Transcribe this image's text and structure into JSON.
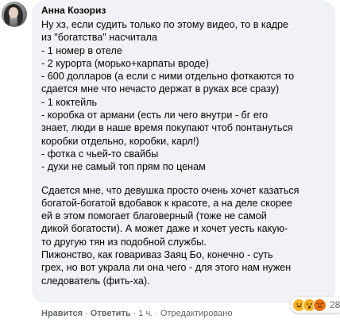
{
  "comment": {
    "author": "Анна Козориз",
    "lines": [
      "Ну хз, если судить только по этому видео, то в кадре",
      "из \"богатства\" насчитала",
      "- 1 номер в отеле",
      "- 2 курорта (морько+карпаты вроде)",
      "- 600 долларов (а если с ними отдельно фоткаются то",
      "сдается мне что нечасто держат в руках все сразу)",
      "- 1 коктейль",
      "- коробка от армани (есть ли чего внутри - бг его",
      "знает, люди в наше время покупают чтоб понтануться",
      "коробки отдельно, коробки, карл!)",
      "- фотка с чьей-то свайбы",
      "- духи не самый топ прям по ценам",
      "",
      "Сдается мне, что девушка просто очень хочет казаться",
      "богатой-богатой вдобавок к красоте, а на деле скорее",
      "ей в этом помогает благоверный (тоже не самой",
      "дикой богатости). А может даже и хочет уесть какую-",
      "то другую тян из подобной службы.",
      "Пижонство, как говариваз Заяц Бо, конечно - суть",
      "грех, но вот украла ли она чего - для этого нам нужен",
      "следователь (фить-ха)."
    ],
    "reactions": {
      "types": [
        "haha",
        "wow",
        "angry"
      ],
      "count": "28"
    },
    "actions": {
      "like": "Нравится",
      "reply": "Ответить",
      "time": "1 ч.",
      "edited": "Отредактировано",
      "separator": "·"
    }
  }
}
